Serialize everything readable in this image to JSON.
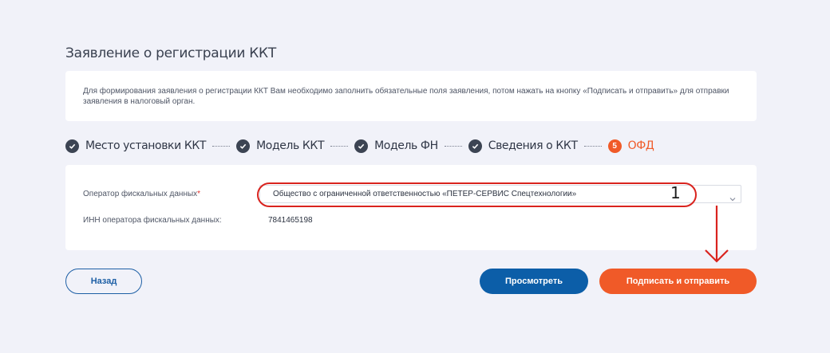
{
  "page": {
    "title": "Заявление о регистрации ККТ",
    "info_text": "Для формирования заявления о регистрации ККТ Вам необходимо заполнить обязательные поля заявления, потом нажать на кнопку «Подписать и отправить» для отправки заявления в налоговый орган."
  },
  "steps": [
    {
      "label": "Место установки ККТ",
      "status": "done"
    },
    {
      "label": "Модель ККТ",
      "status": "done"
    },
    {
      "label": "Модель ФН",
      "status": "done"
    },
    {
      "label": "Сведения о ККТ",
      "status": "done"
    },
    {
      "number": "5",
      "label": "ОФД",
      "status": "active"
    }
  ],
  "form": {
    "ofd_label": "Оператор фискальных данных",
    "required_mark": "*",
    "ofd_value": "Общество с ограниченной ответственностью «ПЕТЕР-СЕРВИС Спецтехнологии»",
    "inn_label": "ИНН оператора фискальных данных:",
    "inn_value": "7841465198"
  },
  "annotation": {
    "number": "1"
  },
  "buttons": {
    "back": "Назад",
    "preview": "Просмотреть",
    "sign_send": "Подписать и отправить"
  },
  "colors": {
    "accent_orange": "#f05a28",
    "primary_blue": "#0c5ea8",
    "annotation_red": "#d9231e"
  }
}
